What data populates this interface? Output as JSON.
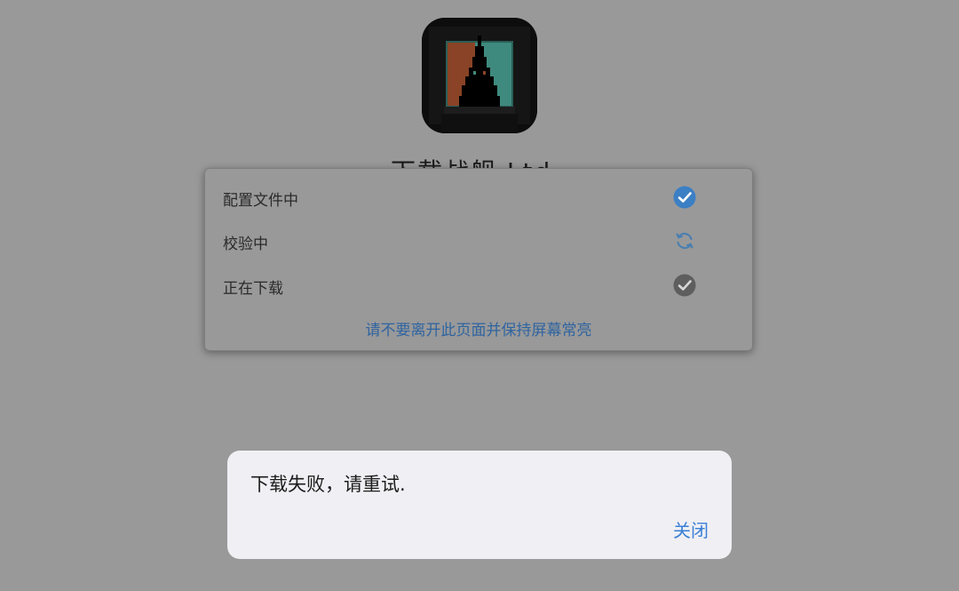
{
  "app": {
    "icon": "pixel-bell-tower-app-icon",
    "title_partial": "下载战舰 Ltd"
  },
  "progress": {
    "steps": [
      {
        "label": "配置文件中",
        "icon": "check-circle-filled-icon",
        "status": "done",
        "color": "#3b7fc4"
      },
      {
        "label": "校验中",
        "icon": "refresh-cycle-icon",
        "status": "in-progress",
        "color": "#4a7fb0"
      },
      {
        "label": "正在下载",
        "icon": "check-circle-gray-icon",
        "status": "pending",
        "color": "#5e5e5e"
      }
    ],
    "notice": "请不要离开此页面并保持屏幕常亮"
  },
  "alert": {
    "message": "下载失败，请重试.",
    "close_label": "关闭"
  },
  "colors": {
    "overlay": "#999999",
    "accent": "#3a7fd5",
    "notice": "#2f64a0",
    "alert_bg": "#efeff4"
  }
}
